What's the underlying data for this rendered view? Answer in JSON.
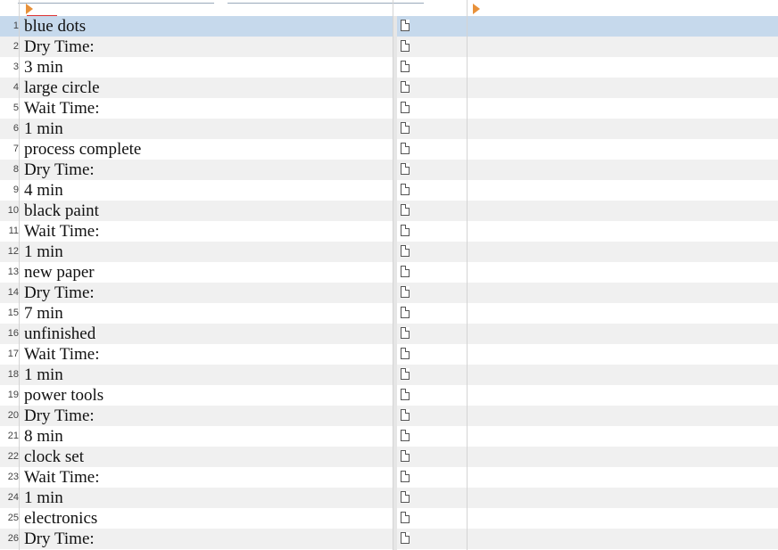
{
  "colors": {
    "selected_row": "#c6d9ec",
    "alt_row": "#f0f0f0",
    "marker": "#e8913a"
  },
  "rows": [
    {
      "num": "1",
      "text": "blue dots"
    },
    {
      "num": "2",
      "text": "Dry Time:"
    },
    {
      "num": "3",
      "text": "3 min"
    },
    {
      "num": "4",
      "text": "large circle"
    },
    {
      "num": "5",
      "text": "Wait Time:"
    },
    {
      "num": "6",
      "text": "1 min"
    },
    {
      "num": "7",
      "text": "process complete"
    },
    {
      "num": "8",
      "text": "Dry Time:"
    },
    {
      "num": "9",
      "text": "4 min"
    },
    {
      "num": "10",
      "text": "black paint"
    },
    {
      "num": "11",
      "text": "Wait Time:"
    },
    {
      "num": "12",
      "text": "1 min"
    },
    {
      "num": "13",
      "text": "new paper"
    },
    {
      "num": "14",
      "text": "Dry Time:"
    },
    {
      "num": "15",
      "text": "7 min"
    },
    {
      "num": "16",
      "text": "unfinished"
    },
    {
      "num": "17",
      "text": "Wait Time:"
    },
    {
      "num": "18",
      "text": "1 min"
    },
    {
      "num": "19",
      "text": "power tools"
    },
    {
      "num": "20",
      "text": "Dry Time:"
    },
    {
      "num": "21",
      "text": "8 min"
    },
    {
      "num": "22",
      "text": "clock set"
    },
    {
      "num": "23",
      "text": "Wait Time:"
    },
    {
      "num": "24",
      "text": "1 min"
    },
    {
      "num": "25",
      "text": "electronics"
    },
    {
      "num": "26",
      "text": "Dry Time:"
    }
  ],
  "selected_row": "1",
  "row_icon": "document-icon"
}
